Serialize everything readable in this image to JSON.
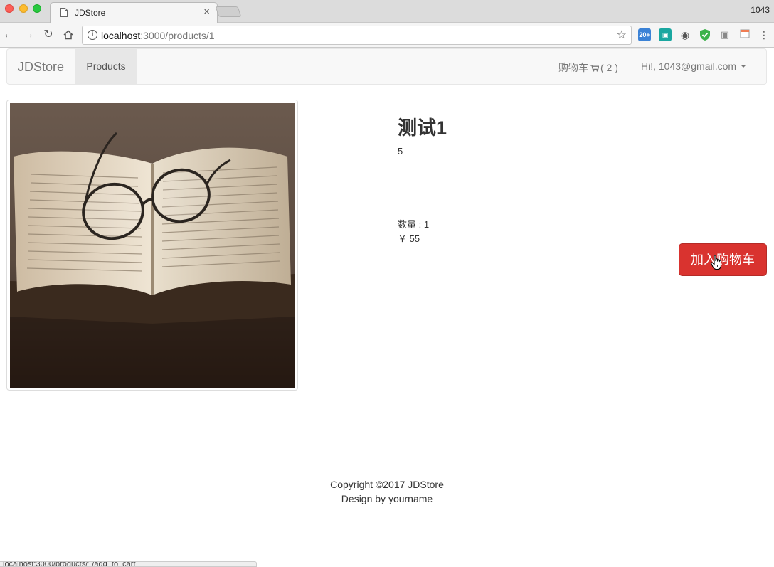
{
  "browser": {
    "tab_title": "JDStore",
    "tab_close": "×",
    "user_count": "1043",
    "url_host": "localhost",
    "url_path": ":3000/products/1",
    "status_url": "localhost:3000/products/1/add_to_cart",
    "extensions": [
      "20+"
    ]
  },
  "navbar": {
    "brand": "JDStore",
    "products_label": "Products",
    "cart_label": "购物车",
    "cart_count": "( 2 )",
    "user_greeting": "Hi!, 1043@gmail.com"
  },
  "product": {
    "title": "测试1",
    "description": "5",
    "quantity": "数量 : 1",
    "price": "￥ 55",
    "add_to_cart_label": "加入购物车",
    "image_alt": "open book with glasses"
  },
  "footer": {
    "copyright": "Copyright ©2017 JDStore",
    "design": "Design by yourname"
  },
  "colors": {
    "add_to_cart": "#d9332f",
    "navbar_bg": "#f8f8f8",
    "active_nav": "#e7e7e7"
  }
}
